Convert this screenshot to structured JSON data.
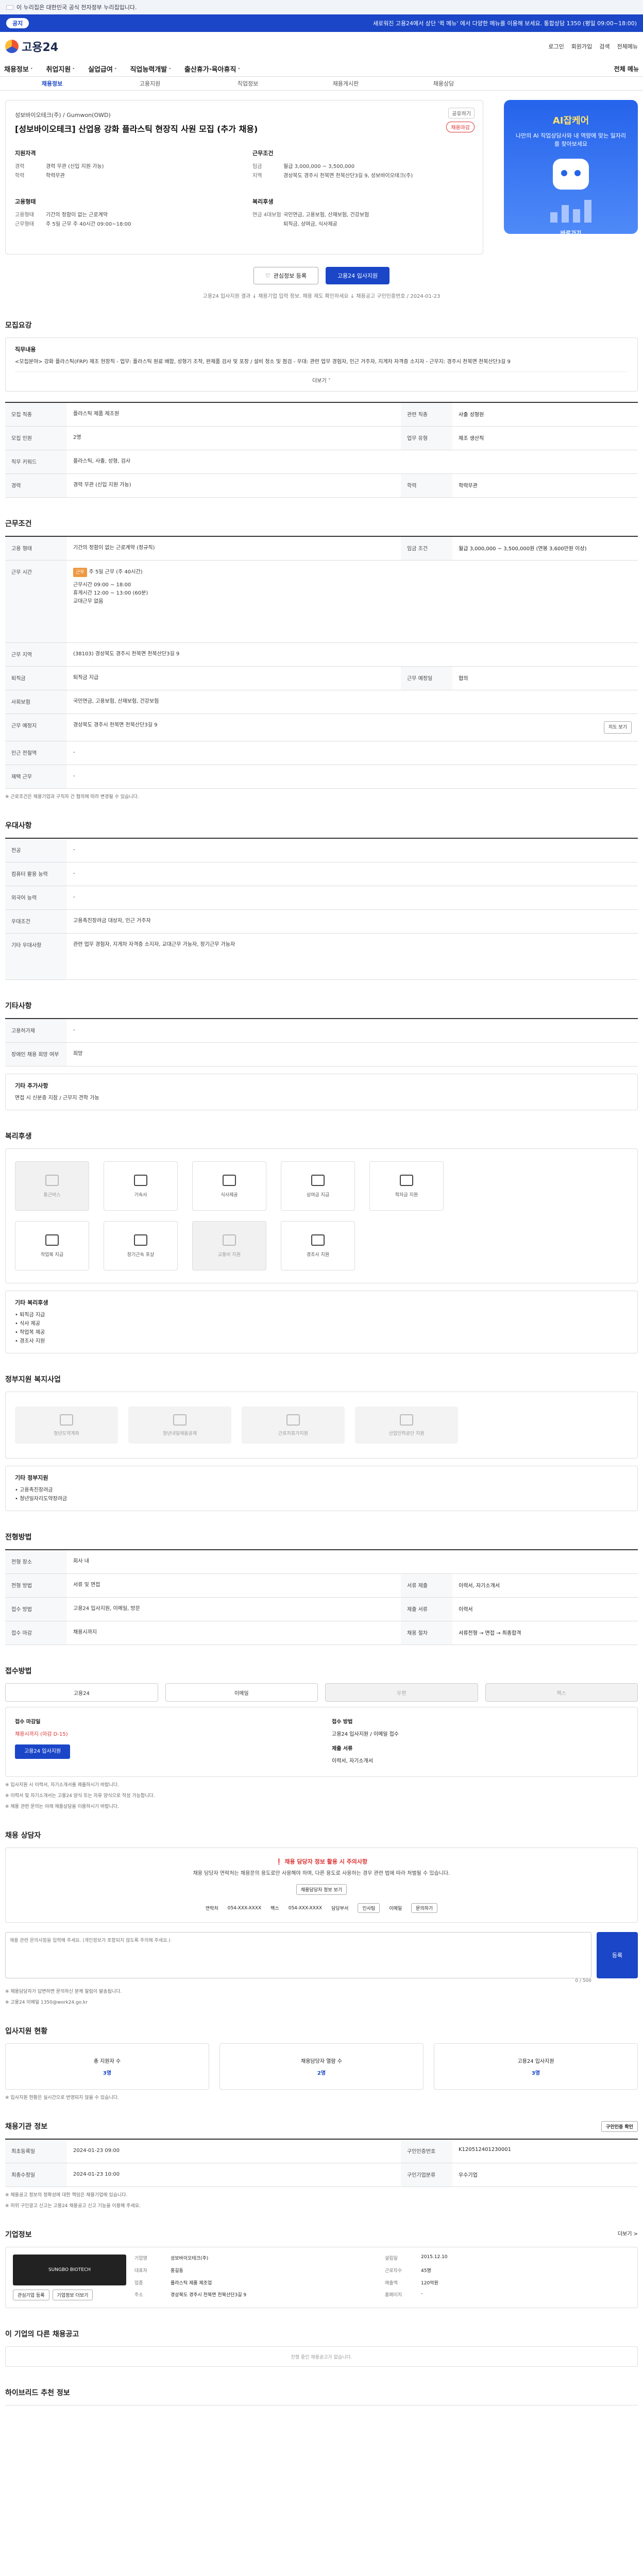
{
  "gov_banner": "이 누리집은 대한민국 공식 전자정부 누리집입니다.",
  "notice": {
    "pill": "공지",
    "message": "새로워진 고용24에서 상단 '퀵 메뉴' 에서 다양한 메뉴를 이용해 보세요. 통합상담 1350 (평일 09:00~18:00)"
  },
  "header": {
    "logo": "고용24",
    "links": [
      "로그인",
      "회원가입",
      "검색",
      "전체메뉴"
    ]
  },
  "gnb": {
    "menu": [
      "채용정보",
      "취업지원",
      "실업급여",
      "직업능력개발",
      "출산휴가·육아휴직"
    ],
    "full": "전체 메뉴"
  },
  "tabs": [
    "채용정보",
    "고용지원",
    "직업정보",
    "채용게시판",
    "채용상담"
  ],
  "job": {
    "company": "성보바이오테크(주) / Gumwon(OWD)",
    "title": "[성보바이오테크] 산업용 강화 플라스틱 현장직 사원 모집 (추가 채용)",
    "share": "공유하기",
    "scrap": "채용마감",
    "experience_h": "지원자격",
    "conditions_h": "근무조건",
    "experience": [
      {
        "k": "경력",
        "v": "경력 무관 (신입 지원 가능)"
      },
      {
        "k": "학력",
        "v": "학력무관"
      }
    ],
    "conditions": [
      {
        "k": "임금",
        "v": "월급 3,000,000 ~ 3,500,000"
      },
      {
        "k": "지역",
        "v": "경상북도 경주시 천북면 천북산단3길 9, 성보바이오테크(주)"
      }
    ],
    "type_h": "고용형태",
    "type": [
      {
        "k": "고용형태",
        "v": "기간의 정함이 없는 근로계약"
      },
      {
        "k": "근무형태",
        "v": "주 5일 근무 주 40시간 09:00~18:00"
      }
    ],
    "welfare_h": "복리후생",
    "welfare": [
      {
        "k": "연금 4대보험",
        "v": "국민연금, 고용보험, 산재보험, 건강보험"
      },
      {
        "k": "",
        "v": "퇴직금, 상여금, 식사제공"
      }
    ],
    "btn_interest": "관심정보 등록",
    "btn_apply": "고용24 입사지원",
    "ref": "고용24 입사지원 결과 ↓ 채용기업 입력 정보. 채용 제도 확인하세요 ↓ 채용공고 구인인증번호 / 2024-01-23"
  },
  "ad": {
    "title": "AI잡케어",
    "subtitle": "나만의 AI 직업상담사와 내 역량에 맞는 일자리를 찾아보세요",
    "cta": "바로가기"
  },
  "recruit": {
    "heading": "모집요강",
    "duties_label": "직무내용",
    "duties": "<모집분야> 강화 플라스틱(FRP) 제조 현장직 - 업무: 플라스틱 원료 배합, 성형기 조작, 완제품 검사 및 포장 / 설비 청소 및 점검 - 우대: 관련 업무 경험자, 인근 거주자, 지게차 자격증 소지자 - 근무지: 경주시 천북면 천북산단3길 9",
    "more": "더보기 ˅",
    "rows": [
      [
        {
          "k": "모집 직종",
          "v": "플라스틱 제품 제조원"
        },
        {
          "k": "관련 직종",
          "v": "사출 성형원"
        }
      ],
      [
        {
          "k": "모집 인원",
          "v": "2명"
        },
        {
          "k": "업무 유형",
          "v": "제조 생산직"
        }
      ],
      [
        {
          "k": "직무 키워드",
          "v": "플라스틱, 사출, 성형, 검사"
        },
        {
          "k": "",
          "v": ""
        }
      ],
      [
        {
          "k": "경력",
          "v": "경력 무관 (신입 지원 가능)"
        },
        {
          "k": "학력",
          "v": "학력무관"
        }
      ]
    ]
  },
  "work": {
    "heading": "근무조건",
    "rows": [
      [
        {
          "k": "고용 형태",
          "v": "기간의 정함이 없는 근로계약 (정규직)"
        },
        {
          "k": "임금 조건",
          "v": "월급 3,000,000 ~ 3,500,000원 (연봉 3,600만원 이상)"
        }
      ],
      [
        {
          "k": "근무 지역",
          "v": "(38103) 경상북도 경주시 천북면 천북산단3길 9"
        },
        {
          "k": "",
          "v": ""
        }
      ]
    ],
    "hours_label": "근무 시간",
    "hours": [
      "주 5일 근무 (주 40시간)",
      "근무시간 09:00 ~ 18:00",
      "휴게시간 12:00 ~ 13:00 (60분)",
      "교대근무 없음"
    ],
    "rows2": [
      [
        {
          "k": "퇴직금",
          "v": "퇴직금 지급"
        },
        {
          "k": "근무 예정일",
          "v": "협의"
        }
      ],
      [
        {
          "k": "사회보험",
          "v": "국민연금, 고용보험, 산재보험, 건강보험"
        },
        {
          "k": "",
          "v": ""
        }
      ],
      [
        {
          "k": "근무 예정지",
          "v": "경상북도 경주시 천북면 천북산단3길 9"
        },
        {
          "k": "",
          "v": ""
        }
      ],
      [
        {
          "k": "인근 전철역",
          "v": "-"
        },
        {
          "k": "",
          "v": ""
        }
      ],
      [
        {
          "k": "재택 근무",
          "v": "-"
        },
        {
          "k": "",
          "v": ""
        }
      ]
    ],
    "map_btn": "지도 보기",
    "note": "※ 근로조건은 채용기업과 구직자 간 협의에 따라 변경될 수 있습니다."
  },
  "qualify": {
    "heading": "우대사항",
    "rows": [
      {
        "k": "전공",
        "v": "-"
      },
      {
        "k": "컴퓨터 활용 능력",
        "v": "-"
      },
      {
        "k": "외국어 능력",
        "v": "-"
      },
      {
        "k": "우대조건",
        "v": "고용촉진장려금 대상자, 인근 거주자"
      },
      {
        "k": "기타 우대사항",
        "v": "관련 업무 경험자, 지게차 자격증 소지자, 교대근무 가능자, 장기근무 가능자"
      }
    ]
  },
  "other": {
    "heading": "기타사항",
    "rows": [
      {
        "k": "고용허가제",
        "v": "-"
      },
      {
        "k": "장애인 채용 희망 여부",
        "v": "희망"
      }
    ],
    "extra_label": "기타 추가사항",
    "extra": "면접 시 신분증 지참 / 근무지 견학 가능"
  },
  "welfare_sec": {
    "heading": "복리후생",
    "items": [
      {
        "icon": "car-icon",
        "label": "통근버스",
        "dim": true
      },
      {
        "icon": "bed-icon",
        "label": "기숙사",
        "dim": false
      },
      {
        "icon": "meal-icon",
        "label": "식사제공",
        "dim": false
      },
      {
        "icon": "trophy-icon",
        "label": "상여금 지급",
        "dim": false
      },
      {
        "icon": "grad-icon",
        "label": "학자금 지원",
        "dim": false
      },
      {
        "icon": "shirt-icon",
        "label": "작업복 지급",
        "dim": false
      },
      {
        "icon": "medal-icon",
        "label": "장기근속 포상",
        "dim": false
      },
      {
        "icon": "bus-icon",
        "label": "교통비 지원",
        "dim": true
      },
      {
        "icon": "gift-icon",
        "label": "경조사 지원",
        "dim": false
      }
    ],
    "list_label": "기타 복리후생",
    "list": [
      "퇴직금 지급",
      "식사 제공",
      "작업복 제공",
      "경조사 지원"
    ]
  },
  "support": {
    "heading": "정부지원 복지사업",
    "items": [
      "청년도약계좌",
      "청년내일채움공제",
      "근로자휴가지원",
      "산업인력공단 지원"
    ],
    "list_label": "기타 정부지원",
    "list": [
      "고용촉진장려금",
      "청년일자리도약장려금"
    ]
  },
  "selection": {
    "heading": "전형방법",
    "rows": [
      [
        {
          "k": "전형 장소",
          "v": "회사 내"
        },
        {
          "k": "",
          "v": ""
        }
      ],
      [
        {
          "k": "전형 방법",
          "v": "서류 및 면접"
        },
        {
          "k": "서류 제출",
          "v": "이력서, 자기소개서"
        }
      ],
      [
        {
          "k": "접수 방법",
          "v": "고용24 입사지원, 이메일, 방문"
        },
        {
          "k": "제출 서류",
          "v": "이력서"
        }
      ],
      [
        {
          "k": "접수 마감",
          "v": "채용시까지"
        },
        {
          "k": "채용 절차",
          "v": "서류전형 → 면접 → 최종합격"
        }
      ]
    ]
  },
  "apply": {
    "heading": "접수방법",
    "methods": [
      {
        "label": "고용24",
        "dim": false
      },
      {
        "label": "이메일",
        "dim": false
      },
      {
        "label": "우편",
        "dim": true
      },
      {
        "label": "팩스",
        "dim": true
      }
    ],
    "col1_h": "접수 마감일",
    "col1_v": "채용시까지 (마감 D-15)",
    "col1_btn": "고용24 입사지원",
    "col2_h": "접수 방법",
    "col2_v": "고용24 입사지원 / 이메일 접수",
    "col2_h2": "제출 서류",
    "col2_v2": "이력서, 자기소개서",
    "notes": [
      "※ 입사지원 시 이력서, 자기소개서를 제출하시기 바랍니다.",
      "※ 이력서 및 자기소개서는 고용24 양식 또는 자유 양식으로 작성 가능합니다.",
      "※ 채용 관련 문의는 아래 채용상담을 이용하시기 바랍니다."
    ]
  },
  "counsel": {
    "heading": "채용 상담자",
    "warn": "채용 담당자 정보 활용 시 주의사항",
    "desc": "채용 담당자 연락처는 채용문의 용도로만 사용해야 하며, 다른 용도로 사용하는 경우 관련 법에 따라 처벌될 수 있습니다.",
    "btn": "채용담당자 정보 보기",
    "contacts": [
      {
        "k": "연락처",
        "v": "054-XXX-XXXX"
      },
      {
        "k": "팩스",
        "v": "054-XXX-XXXX"
      },
      {
        "k": "담당부서",
        "v": "인사팀"
      }
    ],
    "email_k": "이메일",
    "email_v": "문의하기",
    "qa_placeholder": "채용 관련 문의사항을 입력해 주세요. (개인정보가 포함되지 않도록 주의해 주세요.)",
    "qa_count": "0 / 500",
    "qa_btn": "등록",
    "qa_notes": [
      "※ 채용담당자가 답변하면 문의하신 분께 알림이 발송됩니다.",
      "※ 고용24 이메일 1350@work24.go.kr"
    ]
  },
  "shares": {
    "heading": "입사지원 현황",
    "items": [
      {
        "k": "총 지원자 수",
        "v": "3명"
      },
      {
        "k": "채용담당자 열람 수",
        "v": "2명"
      },
      {
        "k": "고용24 입사지원",
        "v": "3명"
      }
    ],
    "note": "※ 입사지원 현황은 실시간으로 반영되지 않을 수 있습니다."
  },
  "info": {
    "heading": "채용기관 정보",
    "btn": "구인인증 확인",
    "rows": [
      [
        {
          "k": "최초등록일",
          "v": "2024-01-23 09:00"
        },
        {
          "k": "구인인증번호",
          "v": "K120512401230001"
        }
      ],
      [
        {
          "k": "최종수정일",
          "v": "2024-01-23 10:00"
        },
        {
          "k": "구인기업분류",
          "v": "우수기업"
        }
      ]
    ],
    "notes": [
      "※ 채용공고 정보의 정확성에 대한 책임은 채용기업에 있습니다.",
      "※ 허위 구인광고 신고는 고용24 채용공고 신고 기능을 이용해 주세요."
    ]
  },
  "company": {
    "heading": "기업정보",
    "more": "더보기 >",
    "logo_text": "SUNGBO BIOTECH",
    "fields": [
      {
        "k": "기업명",
        "v": "성보바이오테크(주)"
      },
      {
        "k": "설립일",
        "v": "2015.12.10"
      },
      {
        "k": "대표자",
        "v": "홍길동"
      },
      {
        "k": "근로자수",
        "v": "45명"
      },
      {
        "k": "업종",
        "v": "플라스틱 제품 제조업"
      },
      {
        "k": "매출액",
        "v": "120억원"
      },
      {
        "k": "주소",
        "v": "경상북도 경주시 천북면 천북산단3길 9"
      },
      {
        "k": "홈페이지",
        "v": "-"
      }
    ],
    "btns": [
      "관심기업 등록",
      "기업정보 더보기"
    ]
  },
  "other_jobs": {
    "heading": "이 기업의 다른 채용공고",
    "empty": "진행 중인 채용공고가 없습니다."
  },
  "similar": {
    "heading": "하이브리드 추천 정보"
  }
}
